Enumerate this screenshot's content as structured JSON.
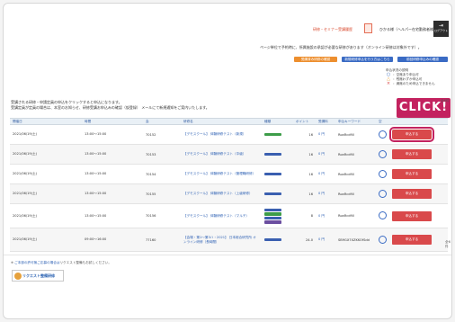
{
  "header": {
    "link_label": "研修・セミナー受講履歴",
    "user_label": "ひかる様（ヘルパー在宅勤務者様）",
    "logout_label": "ログアウト",
    "notice": "ページ単位で予約時に、所属施設の承認が必要な研修があります（オンライン研修は対象外です）。"
  },
  "buttons": {
    "b1": "受講済み研修の確認",
    "b2": "新規研修申込を行う方はこちら",
    "b3": "前回研修申込みの確認"
  },
  "legend": {
    "title": "申込状況の説明",
    "items": [
      {
        "mark": "○",
        "color": "#2b5fb3",
        "label": "：空席あり申込可"
      },
      {
        "mark": "△",
        "color": "#e6a13c",
        "label": "：残席わずか申込可"
      },
      {
        "mark": "×",
        "color": "#d9494b",
        "label": "：満席のため申込できません"
      }
    ]
  },
  "instructions": [
    "受講される研修・申請定員の申込をクリックすると申込になります。",
    "受講定員が定員の場合は、本室のお知らせ、研修受講お申込みの確認（仮登録） メールにて新規通知をご案内いたします。"
  ],
  "counter_top": "全6件",
  "callout": "CLICK!",
  "table": {
    "headers": [
      "開催日",
      "時間",
      "会",
      "研修名",
      "種類",
      "ポイント",
      "受講料",
      "申込キーワード",
      "空",
      ""
    ],
    "rows": [
      {
        "date": "2021/06/19(土)",
        "time": "13:00～15:00",
        "code": "70152",
        "title": "【デモスクール】 体験研修テスト（新規）",
        "chips": [
          "#3d9d49"
        ],
        "points": "16",
        "fee": "0 円",
        "keyword": "RoaRcdfill",
        "apply": "申込する"
      },
      {
        "date": "2021/06/19(土)",
        "time": "13:00～15:00",
        "code": "70153",
        "title": "【デモスクール】 体験研修テスト（中級）",
        "chips": [
          "#3a5fb0"
        ],
        "points": "16",
        "fee": "0 円",
        "keyword": "RoaRcdfill",
        "apply": "申込する"
      },
      {
        "date": "2021/06/19(土)",
        "time": "13:00～15:00",
        "code": "70154",
        "title": "【デモスクール】 体験研修テスト（管理職研修）",
        "chips": [
          "#3a5fb0"
        ],
        "points": "16",
        "fee": "0 円",
        "keyword": "RoaRcdfill",
        "apply": "申込する"
      },
      {
        "date": "2021/06/19(土)",
        "time": "13:00～15:00",
        "code": "70155",
        "title": "【デモスクール】 体験研修テスト（上級研修）",
        "chips": [
          "#3a5fb0"
        ],
        "points": "16",
        "fee": "0 円",
        "keyword": "RoaRcdfill",
        "apply": "申込する"
      },
      {
        "date": "2021/06/19(土)",
        "time": "13:00～15:00",
        "code": "70156",
        "title": "【デモスクール】 体験研修テスト（マルチ）",
        "chips": [
          "#3a5fb0",
          "#3d9d49",
          "#3a5fb0",
          "#6b4ea0"
        ],
        "points": "8",
        "fee": "0 円",
        "keyword": "RoaRcdfill",
        "apply": "申込する"
      },
      {
        "date": "2021/06/19(土)",
        "time": "09:00～16:00",
        "code": "77160",
        "title": "【会場・第1～第3ハ・2021】 日本総合研究所 オンライン研修（長時間）",
        "chips": [
          "#3a5fb0"
        ],
        "points": "24.0",
        "fee": "0 円",
        "keyword": "SB9GX7XZKKOfSdd",
        "apply": "申込する"
      }
    ]
  },
  "counter_bottom": "全6件",
  "footer": {
    "note_prefix": "※ ",
    "note_link": "ご本部の許可無ご応募の場合は",
    "note_suffix": "リクエスト整備もお試しください。",
    "badge": "リクエスト整備研修"
  }
}
